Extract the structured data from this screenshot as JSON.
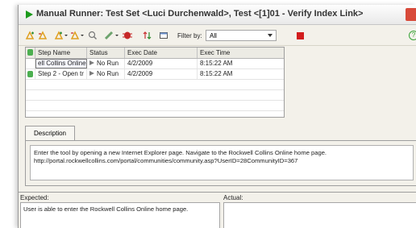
{
  "window": {
    "title": "Manual Runner: Test Set <Luci Durchenwald>, Test <[1]01 - Verify Index Link>"
  },
  "toolbar": {
    "filter_label": "Filter by:",
    "filter_value": "All",
    "icons": [
      "add-step-icon",
      "add-step-after-icon",
      "copy-step-icon",
      "paste-step-icon",
      "find-icon",
      "attach-icon",
      "defects-icon",
      "sort-icon",
      "window-icon",
      "stop-icon",
      "help-icon"
    ]
  },
  "steps_table": {
    "headers": [
      "Step Name",
      "Status",
      "Exec Date",
      "Exec Time"
    ],
    "rows": [
      {
        "name": "ell Collins Online",
        "status": "No Run",
        "date": "4/2/2009",
        "time": "8:15:22 AM"
      },
      {
        "name": "Step 2 - Open tr",
        "status": "No Run",
        "date": "4/2/2009",
        "time": "8:15:22 AM"
      }
    ]
  },
  "description": {
    "tab_label": "Description",
    "line1": "Enter the tool by opening a new Internet Explorer page.  Navigate to the Rockwell Collins Online home page.",
    "line2": "http://portal.rockwellcollins.com/portal/communities/community.asp?UserID=28CommunityID=367"
  },
  "expected": {
    "label": "Expected:",
    "text": "User is able to enter the Rockwell Collins Online home page."
  },
  "actual": {
    "label": "Actual:",
    "text": ""
  },
  "colors": {
    "run_green": "#1b9a1b",
    "stop_red": "#d21d1d",
    "panel": "#f3f1ea"
  }
}
